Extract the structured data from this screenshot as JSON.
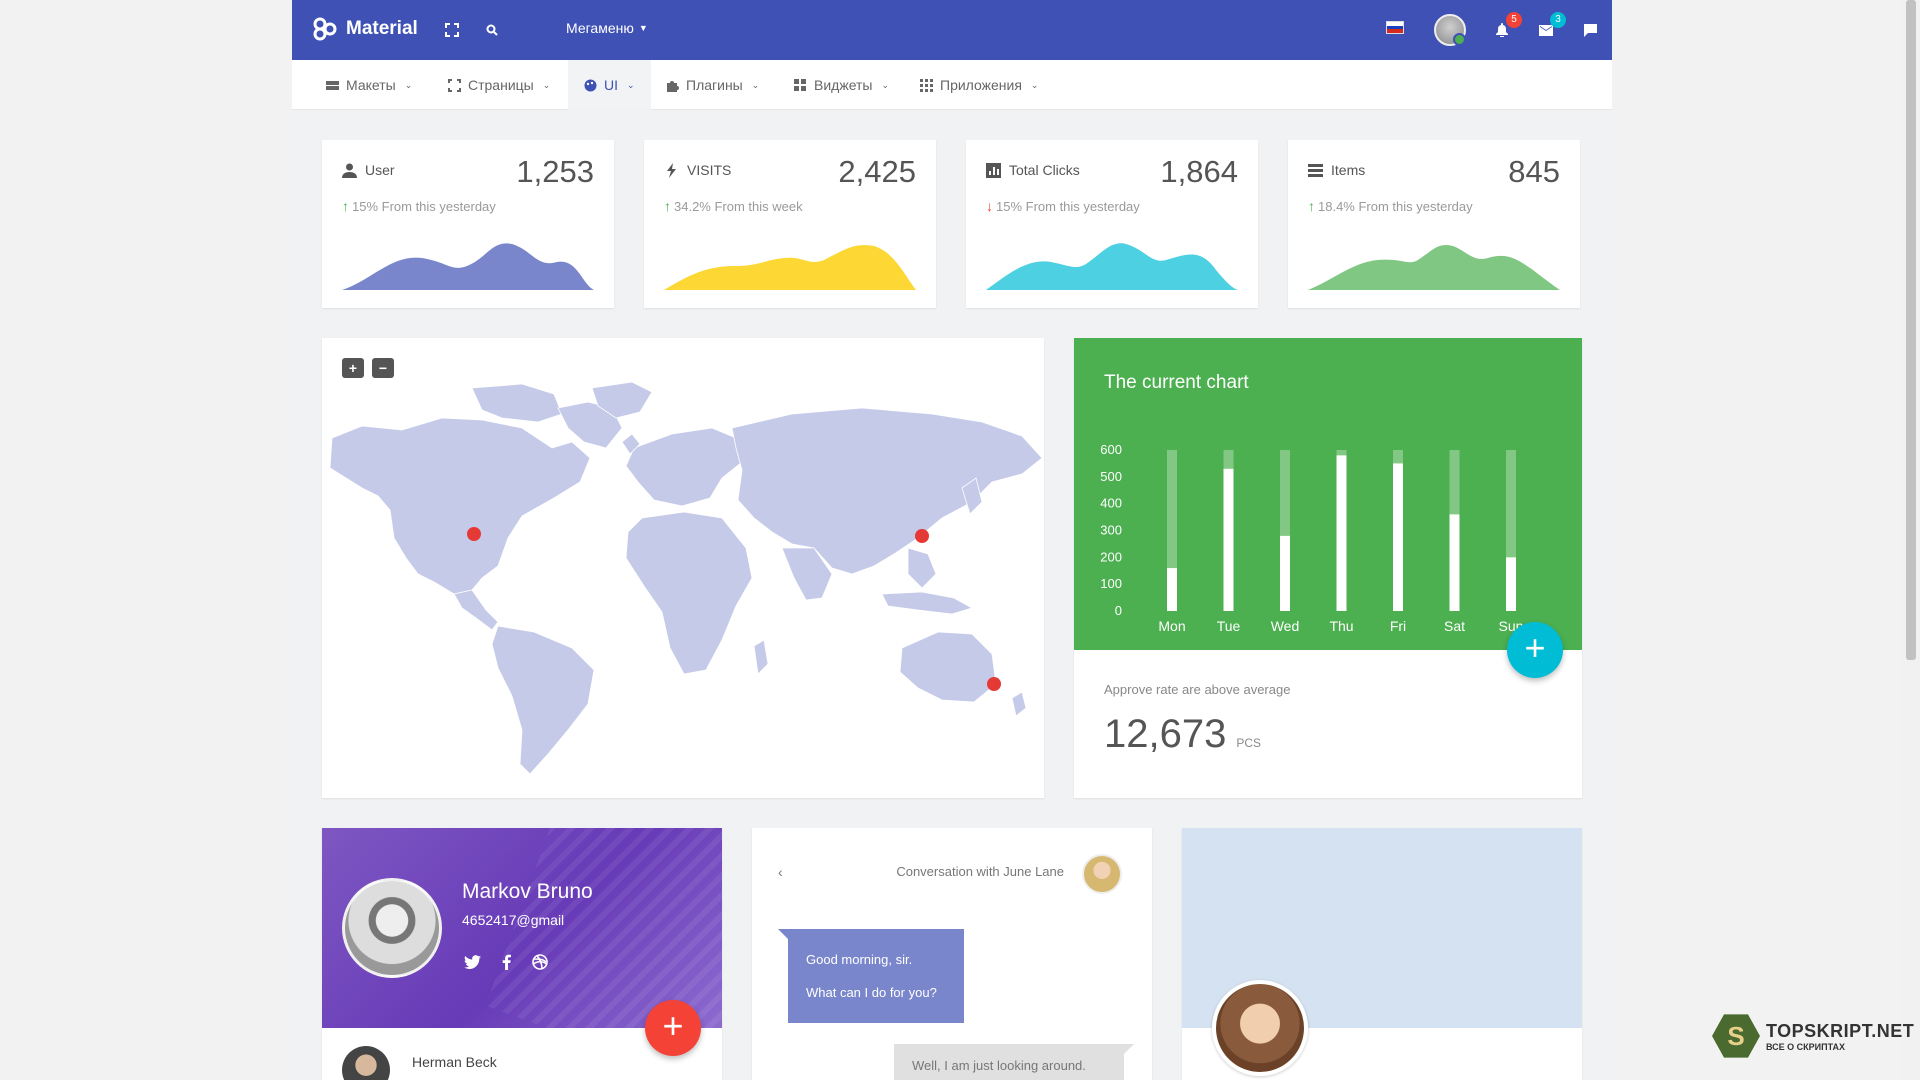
{
  "colors": {
    "primary": "#3f51b5",
    "chart_green": "#4caf50",
    "accent_cyan": "#00bcd4",
    "accent_red": "#f44336",
    "purple": "#673ab7"
  },
  "topbar": {
    "brand": "Material",
    "megamenu_label": "Мегаменю",
    "notifications_count": "5",
    "messages_count": "3",
    "icons": [
      "fullscreen-icon",
      "search-icon",
      "flag-icon",
      "bell-icon",
      "envelope-icon",
      "chat-icon"
    ]
  },
  "menu": {
    "items": [
      {
        "label": "Макеты",
        "icon": "layout-icon"
      },
      {
        "label": "Страницы",
        "icon": "pages-icon"
      },
      {
        "label": "UI",
        "icon": "palette-icon",
        "active": true
      },
      {
        "label": "Плагины",
        "icon": "puzzle-icon"
      },
      {
        "label": "Виджеты",
        "icon": "widgets-icon"
      },
      {
        "label": "Приложения",
        "icon": "apps-icon"
      }
    ]
  },
  "stats": [
    {
      "label": "User",
      "value": "1,253",
      "sub": "15% From this yesterday",
      "trend": "up",
      "color": "#7986cb",
      "icon": "user-icon"
    },
    {
      "label": "VISITS",
      "value": "2,425",
      "sub": "34.2% From this week",
      "trend": "up",
      "color": "#fdd835",
      "icon": "bolt-icon"
    },
    {
      "label": "Total Clicks",
      "value": "1,864",
      "sub": "15% From this yesterday",
      "trend": "down",
      "color": "#4dd0e1",
      "icon": "bar-chart-icon"
    },
    {
      "label": "Items",
      "value": "845",
      "sub": "18.4% From this yesterday",
      "trend": "up",
      "color": "#81c784",
      "icon": "list-icon"
    }
  ],
  "map": {
    "zoom_in": "+",
    "zoom_out": "−",
    "markers": [
      "New York",
      "Beijing",
      "Sydney"
    ]
  },
  "current_chart": {
    "title": "The current chart",
    "approve_text": "Approve rate are above average",
    "total": "12,673",
    "unit": "PCS",
    "fab": "+"
  },
  "chart_data": {
    "type": "bar",
    "categories": [
      "Mon",
      "Tue",
      "Wed",
      "Thu",
      "Fri",
      "Sat",
      "Sun"
    ],
    "values": [
      160,
      530,
      280,
      580,
      550,
      360,
      200
    ],
    "background_max": 600,
    "yticks": [
      0,
      100,
      200,
      300,
      400,
      500,
      600
    ],
    "ylim": [
      0,
      600
    ]
  },
  "profile": {
    "name": "Markov Bruno",
    "email": "4652417@gmail",
    "fab": "+",
    "list_name": "Herman Beck",
    "social": [
      "twitter-icon",
      "facebook-icon",
      "dribbble-icon"
    ]
  },
  "chat": {
    "back": "‹",
    "title": "Conversation with June Lane",
    "messages": {
      "left_1": "Good morning, sir.",
      "left_2": "What can I do for you?",
      "right_1": "Well, I am just looking around."
    }
  },
  "watermark": {
    "letter": "S",
    "brand": "TOPSKRIPT.NET",
    "tagline": "ВСЕ О СКРИПТАХ"
  }
}
